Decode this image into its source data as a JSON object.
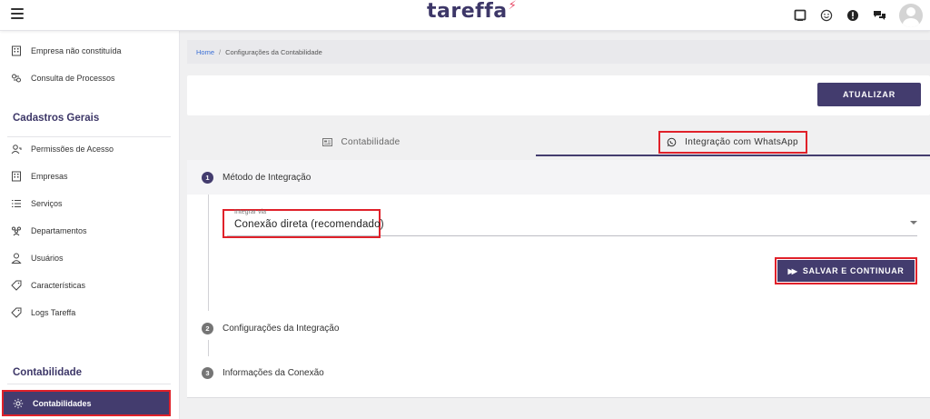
{
  "header": {
    "logo_text": "tareffa",
    "logo_mark": "⚡",
    "icons": [
      "tablet-icon",
      "smile-icon",
      "alert-icon",
      "chat-icon",
      "avatar"
    ]
  },
  "sidebar": {
    "items_top": [
      {
        "label": "Empresa não constituída",
        "icon": "building-icon"
      },
      {
        "label": "Consulta de Processos",
        "icon": "process-icon"
      }
    ],
    "section_cadastros": "Cadastros Gerais",
    "items_cadastros": [
      {
        "label": "Permissões de Acesso",
        "icon": "user-permission-icon"
      },
      {
        "label": "Empresas",
        "icon": "building-icon"
      },
      {
        "label": "Serviços",
        "icon": "list-icon"
      },
      {
        "label": "Departamentos",
        "icon": "group-icon"
      },
      {
        "label": "Usuários",
        "icon": "user-icon"
      },
      {
        "label": "Características",
        "icon": "tag-icon"
      },
      {
        "label": "Logs Tareffa",
        "icon": "tag-icon"
      }
    ],
    "section_contabilidade": "Contabilidade",
    "active_item": {
      "label": "Contabilidades",
      "icon": "gear-icon"
    }
  },
  "breadcrumb": {
    "home": "Home",
    "separator": "/",
    "current": "Configurações da Contabilidade"
  },
  "actions": {
    "atualizar": "ATUALIZAR"
  },
  "tabs": [
    {
      "label": "Contabilidade",
      "icon": "card-icon",
      "active": false
    },
    {
      "label": "Integração com WhatsApp",
      "icon": "whatsapp-icon",
      "active": true
    }
  ],
  "steps": [
    {
      "number": "1",
      "title": "Método de Integração"
    },
    {
      "number": "2",
      "title": "Configurações da Integração"
    },
    {
      "number": "3",
      "title": "Informações da Conexão"
    }
  ],
  "form": {
    "field_label": "Integrar via",
    "field_value": "Conexão direta (recomendado)",
    "submit": "SALVAR E CONTINUAR"
  },
  "colors": {
    "primary": "#433c6e",
    "highlight": "#e0212a",
    "link": "#3b6fd6"
  }
}
